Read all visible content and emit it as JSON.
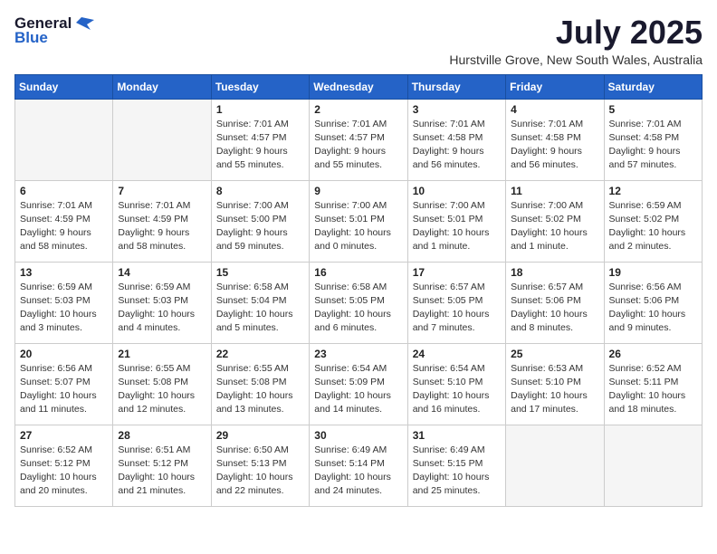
{
  "logo": {
    "general": "General",
    "blue": "Blue"
  },
  "title": {
    "month_year": "July 2025",
    "location": "Hurstville Grove, New South Wales, Australia"
  },
  "weekdays": [
    "Sunday",
    "Monday",
    "Tuesday",
    "Wednesday",
    "Thursday",
    "Friday",
    "Saturday"
  ],
  "weeks": [
    [
      {
        "day": "",
        "info": ""
      },
      {
        "day": "",
        "info": ""
      },
      {
        "day": "1",
        "info": "Sunrise: 7:01 AM\nSunset: 4:57 PM\nDaylight: 9 hours and 55 minutes."
      },
      {
        "day": "2",
        "info": "Sunrise: 7:01 AM\nSunset: 4:57 PM\nDaylight: 9 hours and 55 minutes."
      },
      {
        "day": "3",
        "info": "Sunrise: 7:01 AM\nSunset: 4:58 PM\nDaylight: 9 hours and 56 minutes."
      },
      {
        "day": "4",
        "info": "Sunrise: 7:01 AM\nSunset: 4:58 PM\nDaylight: 9 hours and 56 minutes."
      },
      {
        "day": "5",
        "info": "Sunrise: 7:01 AM\nSunset: 4:58 PM\nDaylight: 9 hours and 57 minutes."
      }
    ],
    [
      {
        "day": "6",
        "info": "Sunrise: 7:01 AM\nSunset: 4:59 PM\nDaylight: 9 hours and 58 minutes."
      },
      {
        "day": "7",
        "info": "Sunrise: 7:01 AM\nSunset: 4:59 PM\nDaylight: 9 hours and 58 minutes."
      },
      {
        "day": "8",
        "info": "Sunrise: 7:00 AM\nSunset: 5:00 PM\nDaylight: 9 hours and 59 minutes."
      },
      {
        "day": "9",
        "info": "Sunrise: 7:00 AM\nSunset: 5:01 PM\nDaylight: 10 hours and 0 minutes."
      },
      {
        "day": "10",
        "info": "Sunrise: 7:00 AM\nSunset: 5:01 PM\nDaylight: 10 hours and 1 minute."
      },
      {
        "day": "11",
        "info": "Sunrise: 7:00 AM\nSunset: 5:02 PM\nDaylight: 10 hours and 1 minute."
      },
      {
        "day": "12",
        "info": "Sunrise: 6:59 AM\nSunset: 5:02 PM\nDaylight: 10 hours and 2 minutes."
      }
    ],
    [
      {
        "day": "13",
        "info": "Sunrise: 6:59 AM\nSunset: 5:03 PM\nDaylight: 10 hours and 3 minutes."
      },
      {
        "day": "14",
        "info": "Sunrise: 6:59 AM\nSunset: 5:03 PM\nDaylight: 10 hours and 4 minutes."
      },
      {
        "day": "15",
        "info": "Sunrise: 6:58 AM\nSunset: 5:04 PM\nDaylight: 10 hours and 5 minutes."
      },
      {
        "day": "16",
        "info": "Sunrise: 6:58 AM\nSunset: 5:05 PM\nDaylight: 10 hours and 6 minutes."
      },
      {
        "day": "17",
        "info": "Sunrise: 6:57 AM\nSunset: 5:05 PM\nDaylight: 10 hours and 7 minutes."
      },
      {
        "day": "18",
        "info": "Sunrise: 6:57 AM\nSunset: 5:06 PM\nDaylight: 10 hours and 8 minutes."
      },
      {
        "day": "19",
        "info": "Sunrise: 6:56 AM\nSunset: 5:06 PM\nDaylight: 10 hours and 9 minutes."
      }
    ],
    [
      {
        "day": "20",
        "info": "Sunrise: 6:56 AM\nSunset: 5:07 PM\nDaylight: 10 hours and 11 minutes."
      },
      {
        "day": "21",
        "info": "Sunrise: 6:55 AM\nSunset: 5:08 PM\nDaylight: 10 hours and 12 minutes."
      },
      {
        "day": "22",
        "info": "Sunrise: 6:55 AM\nSunset: 5:08 PM\nDaylight: 10 hours and 13 minutes."
      },
      {
        "day": "23",
        "info": "Sunrise: 6:54 AM\nSunset: 5:09 PM\nDaylight: 10 hours and 14 minutes."
      },
      {
        "day": "24",
        "info": "Sunrise: 6:54 AM\nSunset: 5:10 PM\nDaylight: 10 hours and 16 minutes."
      },
      {
        "day": "25",
        "info": "Sunrise: 6:53 AM\nSunset: 5:10 PM\nDaylight: 10 hours and 17 minutes."
      },
      {
        "day": "26",
        "info": "Sunrise: 6:52 AM\nSunset: 5:11 PM\nDaylight: 10 hours and 18 minutes."
      }
    ],
    [
      {
        "day": "27",
        "info": "Sunrise: 6:52 AM\nSunset: 5:12 PM\nDaylight: 10 hours and 20 minutes."
      },
      {
        "day": "28",
        "info": "Sunrise: 6:51 AM\nSunset: 5:12 PM\nDaylight: 10 hours and 21 minutes."
      },
      {
        "day": "29",
        "info": "Sunrise: 6:50 AM\nSunset: 5:13 PM\nDaylight: 10 hours and 22 minutes."
      },
      {
        "day": "30",
        "info": "Sunrise: 6:49 AM\nSunset: 5:14 PM\nDaylight: 10 hours and 24 minutes."
      },
      {
        "day": "31",
        "info": "Sunrise: 6:49 AM\nSunset: 5:15 PM\nDaylight: 10 hours and 25 minutes."
      },
      {
        "day": "",
        "info": ""
      },
      {
        "day": "",
        "info": ""
      }
    ]
  ]
}
